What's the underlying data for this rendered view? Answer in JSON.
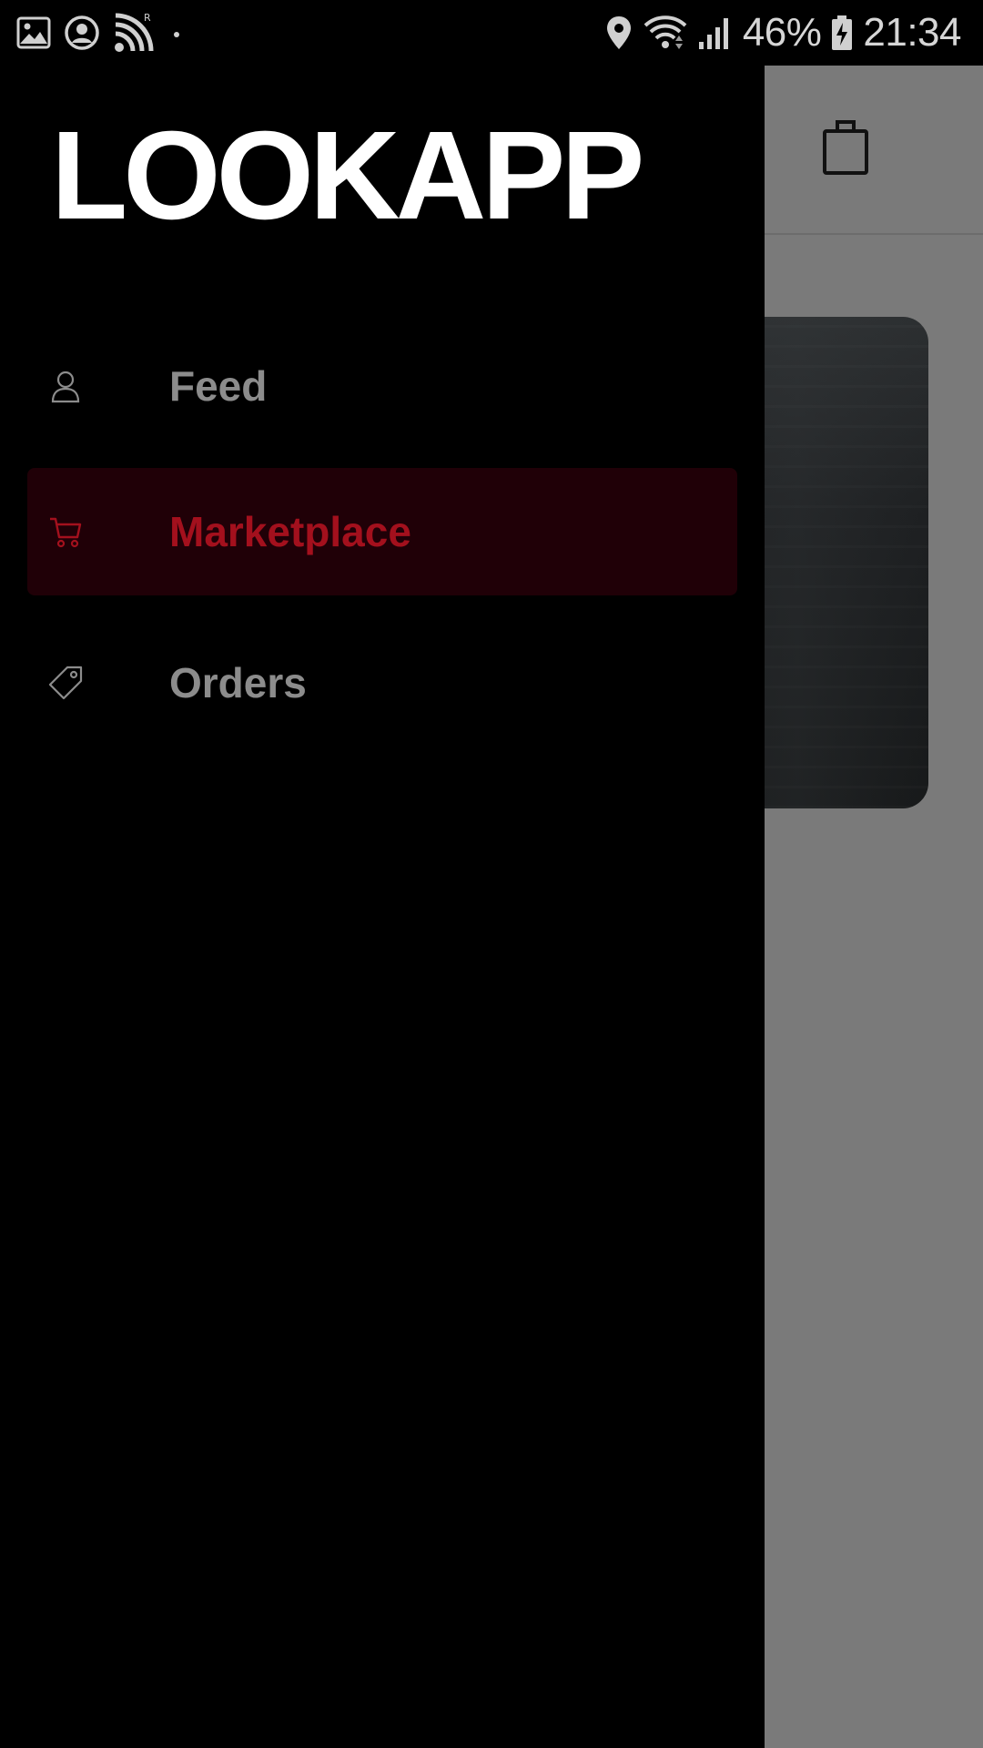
{
  "status_bar": {
    "battery": "46%",
    "time": "21:34"
  },
  "drawer": {
    "brand": "LOOKAPP",
    "items": [
      {
        "label": "Feed",
        "icon": "user-icon",
        "active": false
      },
      {
        "label": "Marketplace",
        "icon": "cart-icon",
        "active": true
      },
      {
        "label": "Orders",
        "icon": "tag-icon",
        "active": false
      }
    ]
  },
  "colors": {
    "accent": "#a3101d",
    "active_background": "#200007",
    "inactive_text": "#8c8c8c",
    "overlay": "#7a7a7a"
  }
}
